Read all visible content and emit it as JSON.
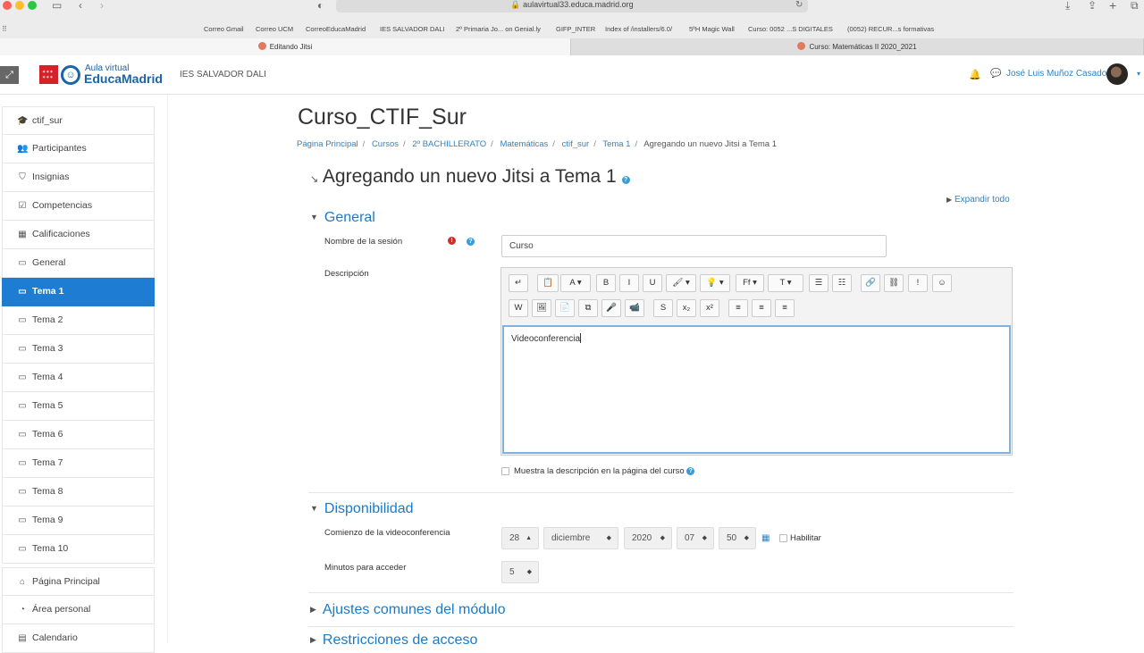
{
  "browser": {
    "url": "aulavirtual33.educa.madrid.org",
    "bookmarks": [
      "Correo Gmail",
      "Correo UCM",
      "CorreoEducaMadrid",
      "IES SALVADOR DALI",
      "2º Primaria Jo... on Genial.ly",
      "GIFP_INTER",
      "Index of /installers/6.0/",
      "5ºH Magic Wall",
      "Curso: 0052 ...S DIGITALES",
      "(0052) RECUR...s formativas"
    ],
    "tabs": [
      "Editando Jitsi",
      "Curso: Matemáticas II 2020_2021"
    ]
  },
  "navbar": {
    "logo_top": "Aula virtual",
    "logo_bottom": "EducaMadrid",
    "site_name": "IES SALVADOR DALI",
    "user_name": "José Luis Muñoz Casado"
  },
  "sidebar": {
    "items": [
      {
        "icon": "graduation-cap-icon",
        "label": "ctif_sur"
      },
      {
        "icon": "users-icon",
        "label": "Participantes"
      },
      {
        "icon": "shield-icon",
        "label": "Insignias"
      },
      {
        "icon": "checkbox-icon",
        "label": "Competencias"
      },
      {
        "icon": "table-icon",
        "label": "Calificaciones"
      },
      {
        "icon": "folder-icon",
        "label": "General"
      },
      {
        "icon": "folder-icon",
        "label": "Tema 1"
      },
      {
        "icon": "folder-icon",
        "label": "Tema 2"
      },
      {
        "icon": "folder-icon",
        "label": "Tema 3"
      },
      {
        "icon": "folder-icon",
        "label": "Tema 4"
      },
      {
        "icon": "folder-icon",
        "label": "Tema 5"
      },
      {
        "icon": "folder-icon",
        "label": "Tema 6"
      },
      {
        "icon": "folder-icon",
        "label": "Tema 7"
      },
      {
        "icon": "folder-icon",
        "label": "Tema 8"
      },
      {
        "icon": "folder-icon",
        "label": "Tema 9"
      },
      {
        "icon": "folder-icon",
        "label": "Tema 10"
      },
      {
        "icon": "home-icon",
        "label": "Página Principal"
      },
      {
        "icon": "dashboard-icon",
        "label": "Área personal"
      },
      {
        "icon": "calendar-icon",
        "label": "Calendario"
      }
    ],
    "active_index": 6
  },
  "main": {
    "course_title": "Curso_CTIF_Sur",
    "breadcrumb": [
      "Página Principal",
      "Cursos",
      "2º BACHILLERATO",
      "Matemáticas",
      "ctif_sur",
      "Tema 1",
      "Agregando un nuevo Jitsi a Tema 1"
    ],
    "heading": "Agregando un nuevo Jitsi a Tema 1",
    "expand_all": "Expandir todo",
    "general": {
      "title": "General",
      "session_label": "Nombre de la sesión",
      "session_value": "Curso",
      "description_label": "Descripción",
      "description_text": "Videoconferencia",
      "show_description": "Muestra la descripción en la página del curso"
    },
    "availability": {
      "title": "Disponibilidad",
      "start_label": "Comienzo de la videoconferencia",
      "day": "28",
      "month": "diciembre",
      "year": "2020",
      "hour": "07",
      "minute": "50",
      "enable_label": "Habilitar",
      "minutes_label": "Minutos para acceder",
      "minutes_value": "5"
    },
    "collapsed_sections": [
      "Ajustes comunes del módulo",
      "Restricciones de acceso"
    ]
  },
  "editor_toolbar": {
    "row1": [
      "↵",
      "📋",
      "A ▾",
      "B",
      "I",
      "U",
      "🖌 ▾",
      "💡 ▾",
      "Ff ▾",
      "T ▾",
      "☰",
      "☷",
      "🔗",
      "⛓",
      "!",
      "☺"
    ],
    "row2": [
      "W",
      "🖼",
      "📄",
      "⧉",
      "🎤",
      "📹",
      "S",
      "x₂",
      "x²",
      "≡",
      "≡",
      "≡"
    ]
  }
}
